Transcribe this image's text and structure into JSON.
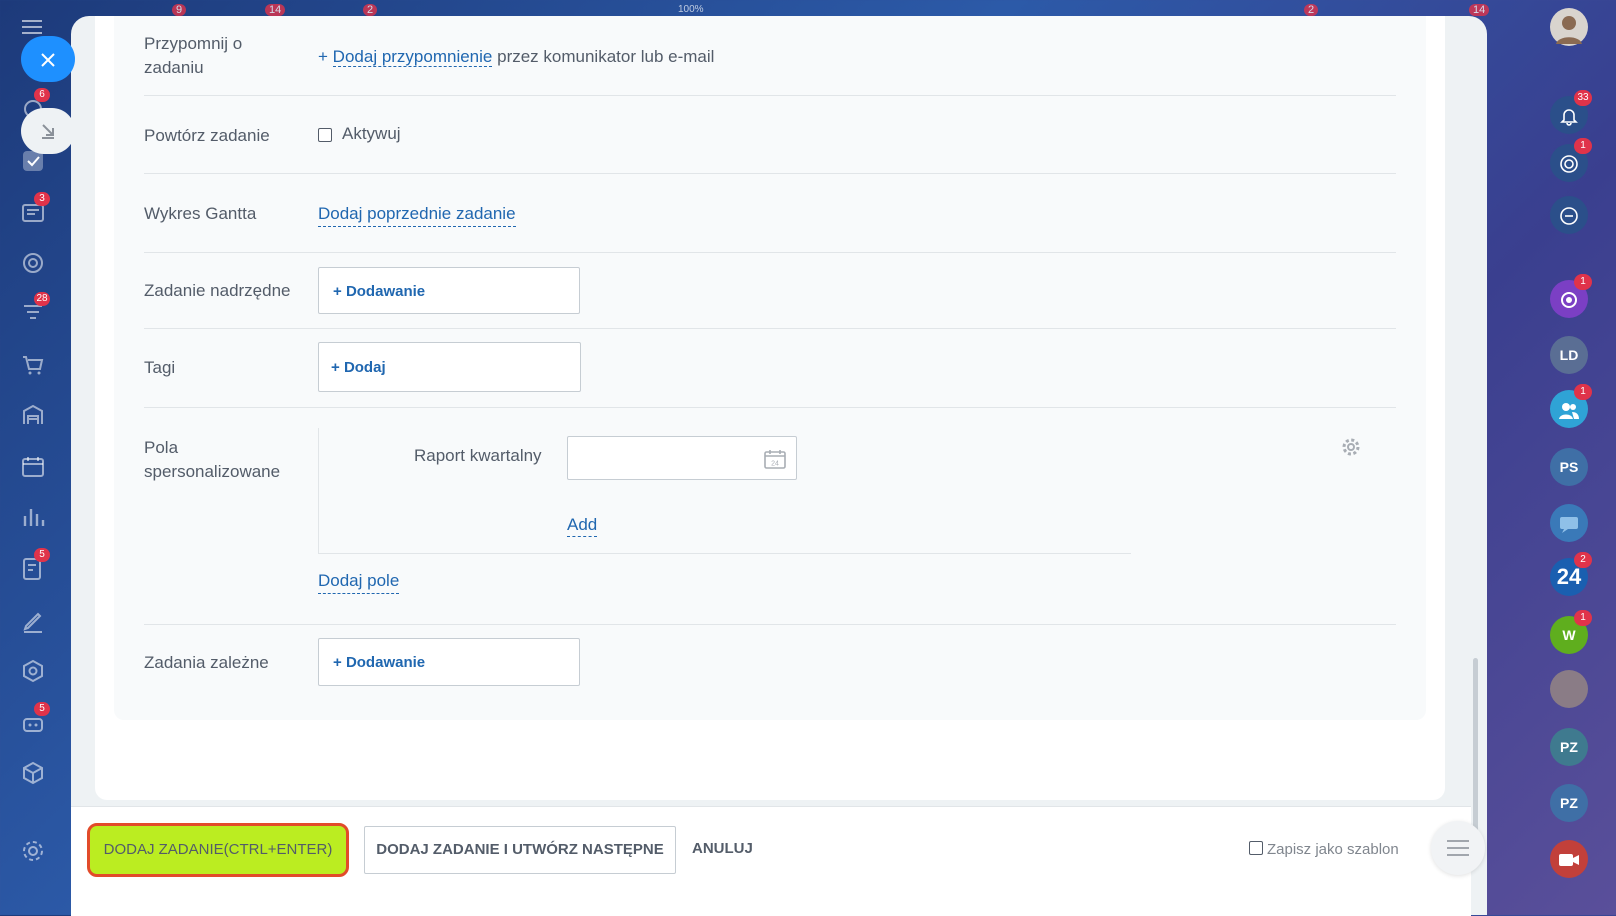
{
  "left_sidebar": {
    "items": [
      {
        "icon": "tasks-icon",
        "badge": "6"
      },
      {
        "icon": "checkbox-icon",
        "badge": ""
      },
      {
        "icon": "news-icon",
        "badge": "3"
      },
      {
        "icon": "target-icon",
        "badge": ""
      },
      {
        "icon": "funnel-icon",
        "badge": "28"
      },
      {
        "icon": "cart-icon",
        "badge": ""
      },
      {
        "icon": "warehouse-icon",
        "badge": ""
      },
      {
        "icon": "calendar-icon",
        "badge": ""
      },
      {
        "icon": "chart-icon",
        "badge": ""
      },
      {
        "icon": "checklist-icon",
        "badge": "5"
      },
      {
        "icon": "sign-icon",
        "badge": ""
      },
      {
        "icon": "hexagon-icon",
        "badge": ""
      },
      {
        "icon": "robot-icon",
        "badge": "5"
      },
      {
        "icon": "box-icon",
        "badge": ""
      },
      {
        "icon": "gear-icon",
        "badge": ""
      }
    ]
  },
  "top_strip": {
    "badges": [
      "9",
      "14",
      "2",
      "2",
      "14"
    ],
    "zoom": "100%"
  },
  "form": {
    "reminder": {
      "label": "Przypomnij o zadaniu",
      "link": "Dodaj przypomnienie",
      "suffix": "przez komunikator lub e-mail"
    },
    "repeat": {
      "label": "Powtórz zadanie",
      "checkbox_label": "Aktywuj"
    },
    "gantt": {
      "label": "Wykres Gantta",
      "link": "Dodaj poprzednie zadanie"
    },
    "parent_task": {
      "label": "Zadanie nadrzędne",
      "button": "Dodawanie"
    },
    "tags": {
      "label": "Tagi",
      "button": "Dodaj"
    },
    "custom_fields": {
      "label": "Pola spersonalizowane",
      "field_label": "Raport kwartalny",
      "calendar_day": "24",
      "add_link": "Add",
      "add_field_link": "Dodaj pole"
    },
    "dependent_tasks": {
      "label": "Zadania zależne",
      "button": "Dodawanie"
    }
  },
  "footer": {
    "primary_button": "DODAJ ZADANIE(CTRL+ENTER)",
    "secondary_button": "DODAJ ZADANIE I UTWÓRZ NASTĘPNE",
    "cancel_button": "ANULUJ",
    "save_template": "Zapisz jako szablon"
  },
  "right_bar": {
    "items": [
      {
        "name": "notifications",
        "text": "",
        "badge": "33",
        "color": "#2b4f8a"
      },
      {
        "name": "targets",
        "text": "",
        "badge": "1",
        "color": "#2b4f8a"
      },
      {
        "name": "chat-search",
        "text": "",
        "badge": "",
        "color": "#2b4f8a"
      },
      {
        "name": "copilot",
        "text": "",
        "badge": "1",
        "color": "#7b3fc4"
      },
      {
        "name": "user-ld",
        "text": "LD",
        "badge": "",
        "color": "#5a6e94"
      },
      {
        "name": "group",
        "text": "",
        "badge": "1",
        "color": "#2fa3d6"
      },
      {
        "name": "user-ps",
        "text": "PS",
        "badge": "",
        "color": "#3f6fa6"
      },
      {
        "name": "messages",
        "text": "",
        "badge": "",
        "color": "#3a79b8"
      },
      {
        "name": "bitrix24",
        "text": "24",
        "badge": "2",
        "color": "#1a5fb0"
      },
      {
        "name": "user-w",
        "text": "W",
        "badge": "1",
        "color": "#5fae1e"
      },
      {
        "name": "group-photo",
        "text": "",
        "badge": "",
        "color": "#8a7c86"
      },
      {
        "name": "user-pz-1",
        "text": "PZ",
        "badge": "",
        "color": "#3f7a8f"
      },
      {
        "name": "user-pz-2",
        "text": "PZ",
        "badge": "",
        "color": "#3f6fa6"
      },
      {
        "name": "video",
        "text": "",
        "badge": "",
        "color": "#c2403a"
      }
    ]
  }
}
